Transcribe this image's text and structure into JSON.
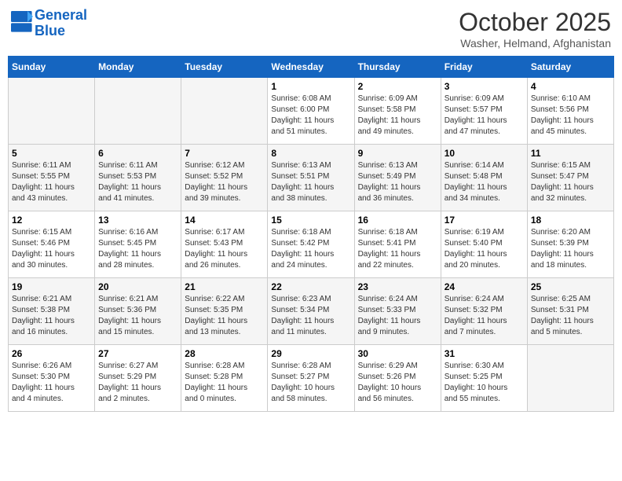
{
  "header": {
    "logo_line1": "General",
    "logo_line2": "Blue",
    "month": "October 2025",
    "location": "Washer, Helmand, Afghanistan"
  },
  "weekdays": [
    "Sunday",
    "Monday",
    "Tuesday",
    "Wednesday",
    "Thursday",
    "Friday",
    "Saturday"
  ],
  "weeks": [
    [
      {
        "day": "",
        "info": ""
      },
      {
        "day": "",
        "info": ""
      },
      {
        "day": "",
        "info": ""
      },
      {
        "day": "1",
        "info": "Sunrise: 6:08 AM\nSunset: 6:00 PM\nDaylight: 11 hours\nand 51 minutes."
      },
      {
        "day": "2",
        "info": "Sunrise: 6:09 AM\nSunset: 5:58 PM\nDaylight: 11 hours\nand 49 minutes."
      },
      {
        "day": "3",
        "info": "Sunrise: 6:09 AM\nSunset: 5:57 PM\nDaylight: 11 hours\nand 47 minutes."
      },
      {
        "day": "4",
        "info": "Sunrise: 6:10 AM\nSunset: 5:56 PM\nDaylight: 11 hours\nand 45 minutes."
      }
    ],
    [
      {
        "day": "5",
        "info": "Sunrise: 6:11 AM\nSunset: 5:55 PM\nDaylight: 11 hours\nand 43 minutes."
      },
      {
        "day": "6",
        "info": "Sunrise: 6:11 AM\nSunset: 5:53 PM\nDaylight: 11 hours\nand 41 minutes."
      },
      {
        "day": "7",
        "info": "Sunrise: 6:12 AM\nSunset: 5:52 PM\nDaylight: 11 hours\nand 39 minutes."
      },
      {
        "day": "8",
        "info": "Sunrise: 6:13 AM\nSunset: 5:51 PM\nDaylight: 11 hours\nand 38 minutes."
      },
      {
        "day": "9",
        "info": "Sunrise: 6:13 AM\nSunset: 5:49 PM\nDaylight: 11 hours\nand 36 minutes."
      },
      {
        "day": "10",
        "info": "Sunrise: 6:14 AM\nSunset: 5:48 PM\nDaylight: 11 hours\nand 34 minutes."
      },
      {
        "day": "11",
        "info": "Sunrise: 6:15 AM\nSunset: 5:47 PM\nDaylight: 11 hours\nand 32 minutes."
      }
    ],
    [
      {
        "day": "12",
        "info": "Sunrise: 6:15 AM\nSunset: 5:46 PM\nDaylight: 11 hours\nand 30 minutes."
      },
      {
        "day": "13",
        "info": "Sunrise: 6:16 AM\nSunset: 5:45 PM\nDaylight: 11 hours\nand 28 minutes."
      },
      {
        "day": "14",
        "info": "Sunrise: 6:17 AM\nSunset: 5:43 PM\nDaylight: 11 hours\nand 26 minutes."
      },
      {
        "day": "15",
        "info": "Sunrise: 6:18 AM\nSunset: 5:42 PM\nDaylight: 11 hours\nand 24 minutes."
      },
      {
        "day": "16",
        "info": "Sunrise: 6:18 AM\nSunset: 5:41 PM\nDaylight: 11 hours\nand 22 minutes."
      },
      {
        "day": "17",
        "info": "Sunrise: 6:19 AM\nSunset: 5:40 PM\nDaylight: 11 hours\nand 20 minutes."
      },
      {
        "day": "18",
        "info": "Sunrise: 6:20 AM\nSunset: 5:39 PM\nDaylight: 11 hours\nand 18 minutes."
      }
    ],
    [
      {
        "day": "19",
        "info": "Sunrise: 6:21 AM\nSunset: 5:38 PM\nDaylight: 11 hours\nand 16 minutes."
      },
      {
        "day": "20",
        "info": "Sunrise: 6:21 AM\nSunset: 5:36 PM\nDaylight: 11 hours\nand 15 minutes."
      },
      {
        "day": "21",
        "info": "Sunrise: 6:22 AM\nSunset: 5:35 PM\nDaylight: 11 hours\nand 13 minutes."
      },
      {
        "day": "22",
        "info": "Sunrise: 6:23 AM\nSunset: 5:34 PM\nDaylight: 11 hours\nand 11 minutes."
      },
      {
        "day": "23",
        "info": "Sunrise: 6:24 AM\nSunset: 5:33 PM\nDaylight: 11 hours\nand 9 minutes."
      },
      {
        "day": "24",
        "info": "Sunrise: 6:24 AM\nSunset: 5:32 PM\nDaylight: 11 hours\nand 7 minutes."
      },
      {
        "day": "25",
        "info": "Sunrise: 6:25 AM\nSunset: 5:31 PM\nDaylight: 11 hours\nand 5 minutes."
      }
    ],
    [
      {
        "day": "26",
        "info": "Sunrise: 6:26 AM\nSunset: 5:30 PM\nDaylight: 11 hours\nand 4 minutes."
      },
      {
        "day": "27",
        "info": "Sunrise: 6:27 AM\nSunset: 5:29 PM\nDaylight: 11 hours\nand 2 minutes."
      },
      {
        "day": "28",
        "info": "Sunrise: 6:28 AM\nSunset: 5:28 PM\nDaylight: 11 hours\nand 0 minutes."
      },
      {
        "day": "29",
        "info": "Sunrise: 6:28 AM\nSunset: 5:27 PM\nDaylight: 10 hours\nand 58 minutes."
      },
      {
        "day": "30",
        "info": "Sunrise: 6:29 AM\nSunset: 5:26 PM\nDaylight: 10 hours\nand 56 minutes."
      },
      {
        "day": "31",
        "info": "Sunrise: 6:30 AM\nSunset: 5:25 PM\nDaylight: 10 hours\nand 55 minutes."
      },
      {
        "day": "",
        "info": ""
      }
    ]
  ]
}
